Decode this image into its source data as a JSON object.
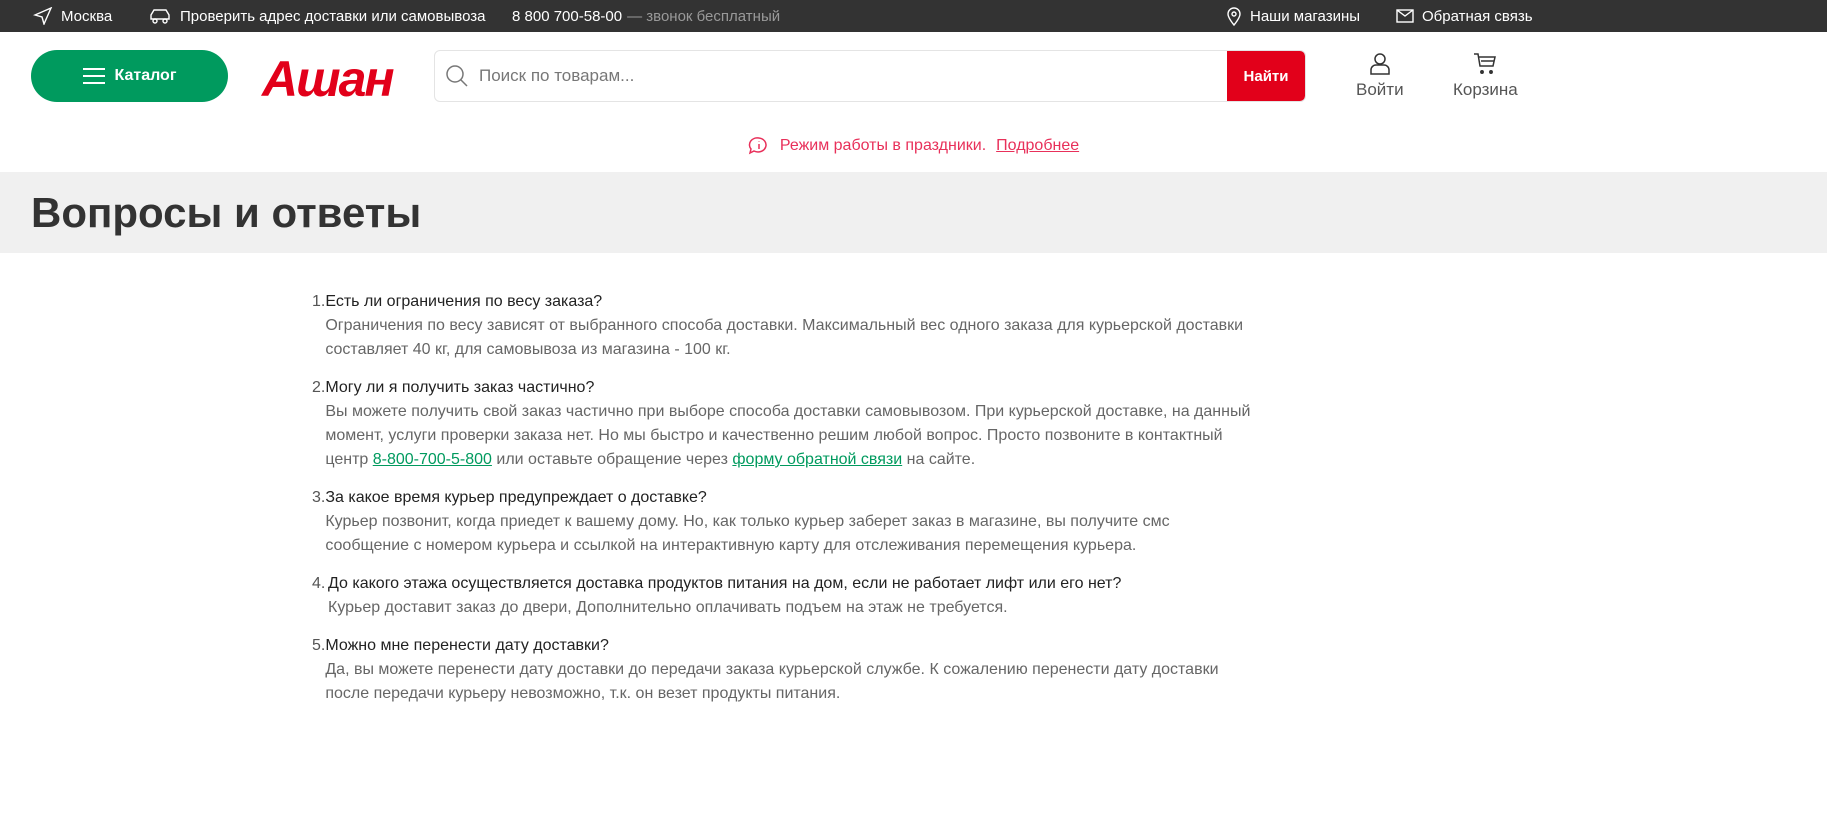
{
  "topbar": {
    "city": "Москва",
    "check_address": "Проверить адрес доставки или самовывоза",
    "phone": "8 800 700-58-00",
    "phone_note": "— звонок бесплатный",
    "stores": "Наши магазины",
    "feedback": "Обратная связь"
  },
  "header": {
    "catalog": "Каталог",
    "logo": "Ашан",
    "search_placeholder": "Поиск по товарам...",
    "search_button": "Найти",
    "login": "Войти",
    "cart": "Корзина"
  },
  "notice": {
    "text": "Режим работы в праздники.",
    "link": "Подробнее"
  },
  "page_title": "Вопросы и ответы",
  "faq": [
    {
      "n": "1.",
      "q": "Есть ли ограничения по весу заказа?",
      "a": "Ограничения по весу зависят от выбранного способа доставки. Максимальный вес одного заказа для курьерской доставки составляет 40 кг, для самовывоза из магазина - 100 кг."
    },
    {
      "n": "2.",
      "q": "Могу ли я получить заказ частично?",
      "a1": "Вы можете получить свой заказ частично при выборе способа доставки самовывозом. При курьерской доставке, на данный момент, услуги проверки заказа нет. Но мы быстро и качественно решим любой вопрос. Просто позвоните в контактный центр ",
      "phone": "8-800-700-5-800",
      "a2": " или оставьте обращение через ",
      "link": "форму обратной связи",
      "a3": " на сайте."
    },
    {
      "n": "3.",
      "q": "За какое время курьер предупреждает о доставке?",
      "a": "Курьер позвонит, когда приедет к вашему дому. Но, как только курьер заберет заказ в магазине, вы получите смс сообщение с номером курьера и ссылкой на интерактивную карту для отслеживания перемещения курьера."
    },
    {
      "n": "4.",
      "q": "До какого этажа осуществляется доставка продуктов питания на дом, если не работает лифт или его нет?",
      "a": "Курьер доставит заказ до двери, Дополнительно оплачивать подъем на этаж не требуется."
    },
    {
      "n": "5.",
      "q": "Можно мне перенести дату доставки?",
      "a": "Да, вы можете перенести дату доставки до передачи заказа курьерской службе. К сожалению перенести дату доставки после передачи курьеру невозможно, т.к. он везет продукты питания."
    }
  ]
}
